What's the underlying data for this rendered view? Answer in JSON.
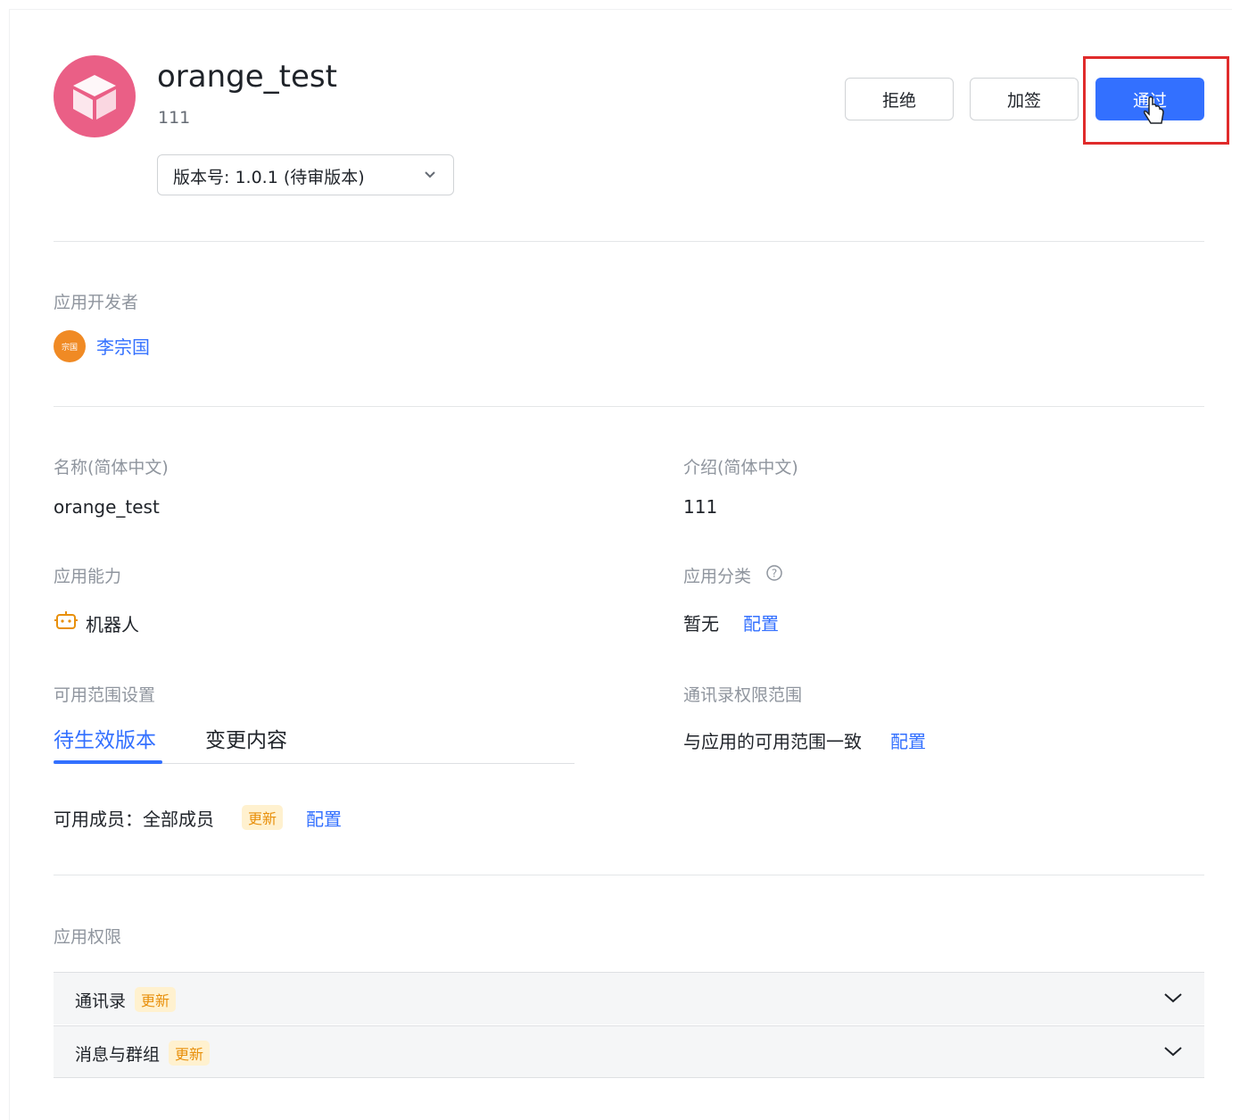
{
  "header": {
    "app_name": "orange_test",
    "app_desc": "111",
    "version_label": "版本号: 1.0.1 (待审版本)",
    "icon": "cube-icon"
  },
  "actions": {
    "reject": "拒绝",
    "add_sign": "加签",
    "approve": "通过"
  },
  "developer": {
    "label": "应用开发者",
    "avatar_text": "宗国",
    "name": "李宗国"
  },
  "fields": {
    "name_label": "名称(简体中文)",
    "name_value": "orange_test",
    "intro_label": "介绍(简体中文)",
    "intro_value": "111",
    "capability_label": "应用能力",
    "capability_value": "机器人",
    "category_label": "应用分类",
    "category_value": "暂无",
    "category_action": "配置",
    "scope_label": "可用范围设置",
    "contacts_scope_label": "通讯录权限范围",
    "contacts_scope_value": "与应用的可用范围一致",
    "contacts_scope_action": "配置"
  },
  "tabs": [
    {
      "label": "待生效版本",
      "active": true
    },
    {
      "label": "变更内容",
      "active": false
    }
  ],
  "members": {
    "text": "可用成员：全部成员",
    "badge": "更新",
    "action": "配置"
  },
  "permissions": {
    "label": "应用权限",
    "items": [
      {
        "name": "通讯录",
        "badge": "更新"
      },
      {
        "name": "消息与群组",
        "badge": "更新"
      }
    ]
  },
  "colors": {
    "accent": "#3370ff",
    "app_icon": "#ea5f86",
    "badge_bg": "#fff1cf",
    "badge_text": "#e8900c",
    "highlight": "#e02b2b"
  }
}
